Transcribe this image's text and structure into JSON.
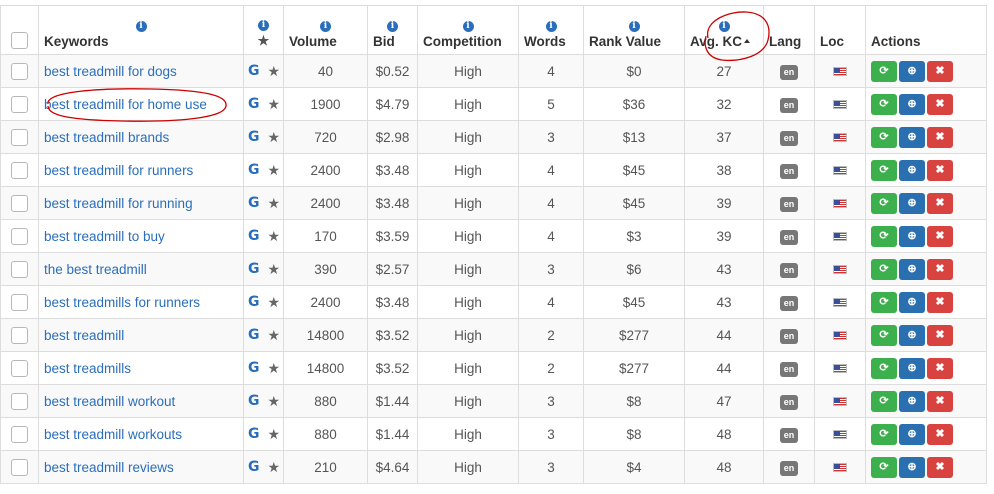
{
  "headers": {
    "keywords": "Keywords",
    "volume": "Volume",
    "bid": "Bid",
    "competition": "Competition",
    "words": "Words",
    "rank_value": "Rank Value",
    "avg_kc": "Avg. KC",
    "lang": "Lang",
    "loc": "Loc",
    "actions": "Actions",
    "info_glyph": "i"
  },
  "rows": [
    {
      "keyword": "best treadmill for dogs",
      "volume": "40",
      "bid": "$0.52",
      "competition": "High",
      "words": "4",
      "rank_value": "$0",
      "avg_kc": "27",
      "lang": "en"
    },
    {
      "keyword": "best treadmill for home use",
      "volume": "1900",
      "bid": "$4.79",
      "competition": "High",
      "words": "5",
      "rank_value": "$36",
      "avg_kc": "32",
      "lang": "en"
    },
    {
      "keyword": "best treadmill brands",
      "volume": "720",
      "bid": "$2.98",
      "competition": "High",
      "words": "3",
      "rank_value": "$13",
      "avg_kc": "37",
      "lang": "en"
    },
    {
      "keyword": "best treadmill for runners",
      "volume": "2400",
      "bid": "$3.48",
      "competition": "High",
      "words": "4",
      "rank_value": "$45",
      "avg_kc": "38",
      "lang": "en"
    },
    {
      "keyword": "best treadmill for running",
      "volume": "2400",
      "bid": "$3.48",
      "competition": "High",
      "words": "4",
      "rank_value": "$45",
      "avg_kc": "39",
      "lang": "en"
    },
    {
      "keyword": "best treadmill to buy",
      "volume": "170",
      "bid": "$3.59",
      "competition": "High",
      "words": "4",
      "rank_value": "$3",
      "avg_kc": "39",
      "lang": "en"
    },
    {
      "keyword": "the best treadmill",
      "volume": "390",
      "bid": "$2.57",
      "competition": "High",
      "words": "3",
      "rank_value": "$6",
      "avg_kc": "43",
      "lang": "en"
    },
    {
      "keyword": "best treadmills for runners",
      "volume": "2400",
      "bid": "$3.48",
      "competition": "High",
      "words": "4",
      "rank_value": "$45",
      "avg_kc": "43",
      "lang": "en"
    },
    {
      "keyword": "best treadmill",
      "volume": "14800",
      "bid": "$3.52",
      "competition": "High",
      "words": "2",
      "rank_value": "$277",
      "avg_kc": "44",
      "lang": "en"
    },
    {
      "keyword": "best treadmills",
      "volume": "14800",
      "bid": "$3.52",
      "competition": "High",
      "words": "2",
      "rank_value": "$277",
      "avg_kc": "44",
      "lang": "en"
    },
    {
      "keyword": "best treadmill workout",
      "volume": "880",
      "bid": "$1.44",
      "competition": "High",
      "words": "3",
      "rank_value": "$8",
      "avg_kc": "47",
      "lang": "en"
    },
    {
      "keyword": "best treadmill workouts",
      "volume": "880",
      "bid": "$1.44",
      "competition": "High",
      "words": "3",
      "rank_value": "$8",
      "avg_kc": "48",
      "lang": "en"
    },
    {
      "keyword": "best treadmill reviews",
      "volume": "210",
      "bid": "$4.64",
      "competition": "High",
      "words": "3",
      "rank_value": "$4",
      "avg_kc": "48",
      "lang": "en"
    }
  ],
  "google_glyph": "G",
  "colors": {
    "link": "#2a6ebb",
    "refresh_button": "#3cb04c",
    "zoom_button": "#2a6fb0",
    "delete_button": "#d9433f",
    "annotation": "#cc0000"
  },
  "icons": {
    "refresh": "refresh-icon",
    "zoom": "zoom-in-icon",
    "delete": "close-icon",
    "star": "star-icon",
    "google": "google-icon",
    "flag": "us-flag-icon"
  }
}
